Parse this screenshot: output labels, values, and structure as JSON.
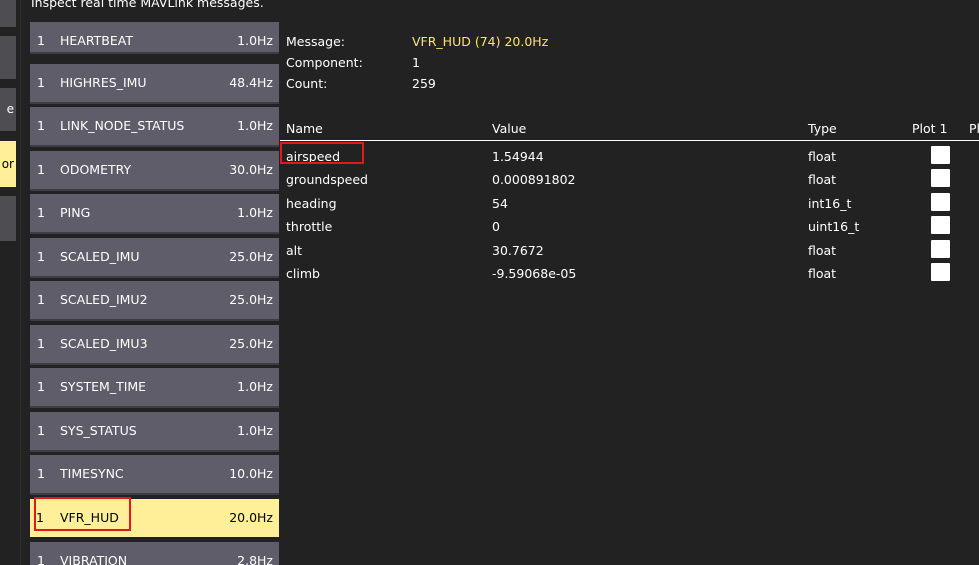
{
  "header": {
    "text": "Inspect real time MAVLink messages."
  },
  "sidebar": {
    "items": [
      {
        "label": ""
      },
      {
        "label": ""
      },
      {
        "label": "e"
      },
      {
        "label": "or"
      },
      {
        "label": ""
      }
    ],
    "active_index": 3
  },
  "messages": [
    {
      "component": "1",
      "name": "HEARTBEAT",
      "rate": "1.0Hz"
    },
    {
      "component": "1",
      "name": "HIGHRES_IMU",
      "rate": "48.4Hz"
    },
    {
      "component": "1",
      "name": "LINK_NODE_STATUS",
      "rate": "1.0Hz"
    },
    {
      "component": "1",
      "name": "ODOMETRY",
      "rate": "30.0Hz"
    },
    {
      "component": "1",
      "name": "PING",
      "rate": "1.0Hz"
    },
    {
      "component": "1",
      "name": "SCALED_IMU",
      "rate": "25.0Hz"
    },
    {
      "component": "1",
      "name": "SCALED_IMU2",
      "rate": "25.0Hz"
    },
    {
      "component": "1",
      "name": "SCALED_IMU3",
      "rate": "25.0Hz"
    },
    {
      "component": "1",
      "name": "SYSTEM_TIME",
      "rate": "1.0Hz"
    },
    {
      "component": "1",
      "name": "SYS_STATUS",
      "rate": "1.0Hz"
    },
    {
      "component": "1",
      "name": "TIMESYNC",
      "rate": "10.0Hz"
    },
    {
      "component": "1",
      "name": "VFR_HUD",
      "rate": "20.0Hz"
    },
    {
      "component": "1",
      "name": "VIBRATION",
      "rate": "2.8Hz"
    }
  ],
  "selected_message_index": 11,
  "details": {
    "message_label": "Message:",
    "message_value": "VFR_HUD (74) 20.0Hz",
    "component_label": "Component:",
    "component_value": "1",
    "count_label": "Count:",
    "count_value": "259"
  },
  "table": {
    "headers": {
      "name": "Name",
      "value": "Value",
      "type": "Type",
      "plot1": "Plot 1",
      "plot2": "Pl"
    },
    "rows": [
      {
        "name": "airspeed",
        "value": "1.54944",
        "type": "float"
      },
      {
        "name": "groundspeed",
        "value": "0.000891802",
        "type": "float"
      },
      {
        "name": "heading",
        "value": "54",
        "type": "int16_t"
      },
      {
        "name": "throttle",
        "value": "0",
        "type": "uint16_t"
      },
      {
        "name": "alt",
        "value": "30.7672",
        "type": "float"
      },
      {
        "name": "climb",
        "value": "-9.59068e-05",
        "type": "float"
      }
    ]
  },
  "colors": {
    "background": "#222222",
    "list_item": "#5f5d6a",
    "selected_item": "#ffef99",
    "message_value": "#ffe36b",
    "highlight_box": "#e0191b"
  }
}
